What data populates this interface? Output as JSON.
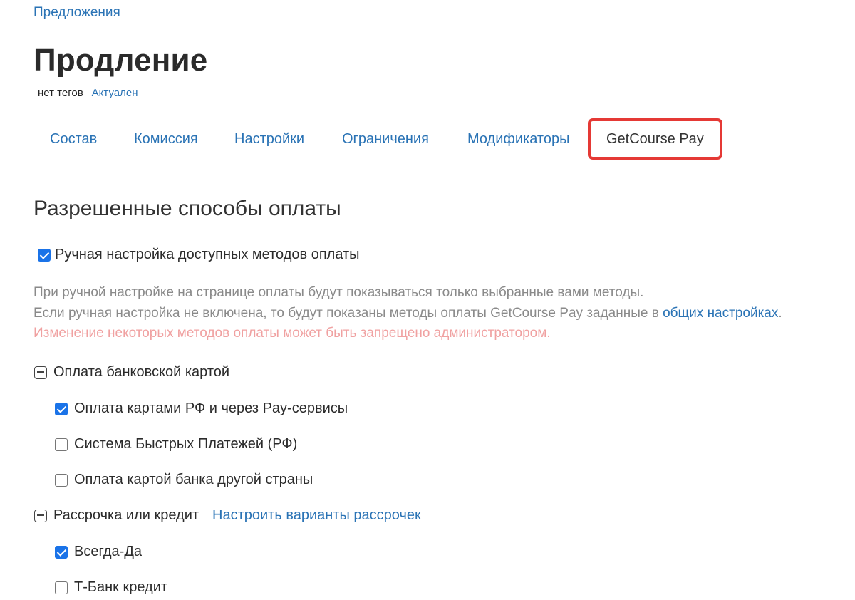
{
  "breadcrumb": "Предложения",
  "title": "Продление",
  "tags": {
    "none_label": "нет тегов",
    "status": "Актуален"
  },
  "tabs": [
    {
      "label": "Состав"
    },
    {
      "label": "Комиссия"
    },
    {
      "label": "Настройки"
    },
    {
      "label": "Ограничения"
    },
    {
      "label": "Модификаторы"
    },
    {
      "label": "GetCourse Pay"
    }
  ],
  "section": {
    "title": "Разрешенные способы оплаты",
    "manual_setup_label": "Ручная настройка доступных методов оплаты",
    "hint_line1": "При ручной настройке на странице оплаты будут показываться только выбранные вами методы.",
    "hint_line2_prefix": "Если ручная настройка не включена, то будут показаны методы оплаты GetCourse Pay заданные в ",
    "hint_line2_link": "общих настройках",
    "hint_line2_suffix": ".",
    "hint_warning": "Изменение некоторых методов оплаты может быть запрещено администратором."
  },
  "groups": {
    "card": {
      "label": "Оплата банковской картой",
      "items": [
        {
          "label": "Оплата картами РФ и через Pay-сервисы",
          "checked": true
        },
        {
          "label": "Система Быстрых Платежей (РФ)",
          "checked": false
        },
        {
          "label": "Оплата картой банка другой страны",
          "checked": false
        }
      ]
    },
    "credit": {
      "label": "Рассрочка или кредит",
      "link": "Настроить варианты рассрочек",
      "items": [
        {
          "label": "Всегда-Да",
          "checked": true
        },
        {
          "label": "Т-Банк кредит",
          "checked": false
        }
      ]
    }
  },
  "colors": {
    "link": "#2a73b5",
    "active_tab_outline": "#e53935",
    "checkbox_checked": "#1a73e8",
    "warning_text": "#f0a1a1"
  }
}
